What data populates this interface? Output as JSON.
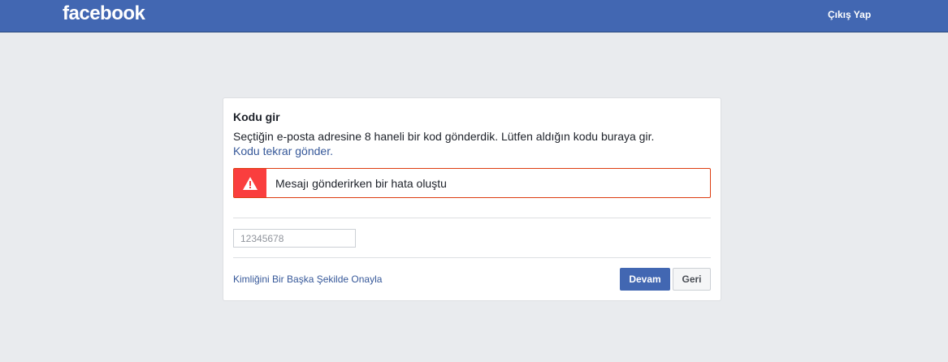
{
  "header": {
    "logo": "facebook",
    "logout_label": "Çıkış Yap"
  },
  "card": {
    "title": "Kodu gir",
    "description": "Seçtiğin e-posta adresine 8 haneli bir kod gönderdik. Lütfen aldığın kodu buraya gir.",
    "resend_link": "Kodu tekrar gönder.",
    "error": {
      "icon": "warning-icon",
      "message": "Mesajı gönderirken bir hata oluştu"
    },
    "code_input": {
      "value": "",
      "placeholder": "12345678"
    },
    "alt_verify_link": "Kimliğini Bir Başka Şekilde Onayla",
    "continue_label": "Devam",
    "back_label": "Geri"
  },
  "colors": {
    "brand": "#4267b2",
    "error": "#fa3e3e",
    "link": "#365899"
  }
}
